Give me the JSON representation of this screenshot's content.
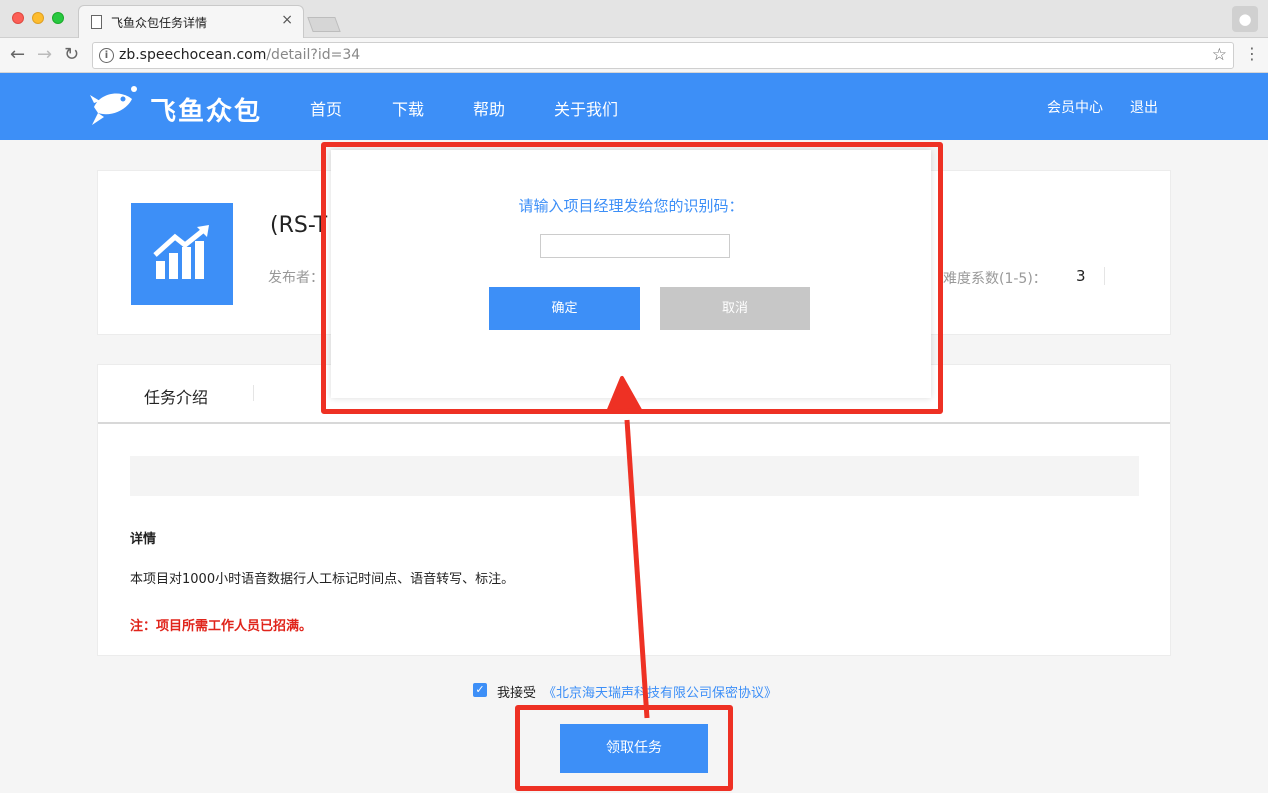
{
  "browser": {
    "tab_title": "飞鱼众包任务详情",
    "tab_close": "×",
    "url_host": "zb.speechocean.com",
    "url_path": "/detail?id=34",
    "icons": [
      "page-icon",
      "back-icon",
      "forward-icon",
      "reload-icon",
      "info-icon",
      "star-icon",
      "menu-icon",
      "profile-icon"
    ]
  },
  "header": {
    "logo_text": "飞鱼众包",
    "nav": [
      "首页",
      "下载",
      "帮助",
      "关于我们"
    ],
    "member_center": "会员中心",
    "logout": "退出",
    "color": "#3d8ff7"
  },
  "task": {
    "name": "(RS-T",
    "publisher_label": "发布者：",
    "difficulty_label": "难度系数(1-5)：",
    "difficulty_value": "3"
  },
  "intro": {
    "tab_label": "任务介绍",
    "detail_title": "详情",
    "detail_text": "本项目对1000小时语音数据行人工标记时间点、语音转写、标注。",
    "note": "注：项目所需工作人员已招满。"
  },
  "agreement": {
    "checked": true,
    "text": "我接受",
    "link": "《北京海天瑞声科技有限公司保密协议》"
  },
  "claim_button": "领取任务",
  "modal": {
    "prompt": "请输入项目经理发给您的识别码：",
    "input_value": "",
    "ok": "确定",
    "cancel": "取消"
  },
  "annotation_color": "#ee3124"
}
